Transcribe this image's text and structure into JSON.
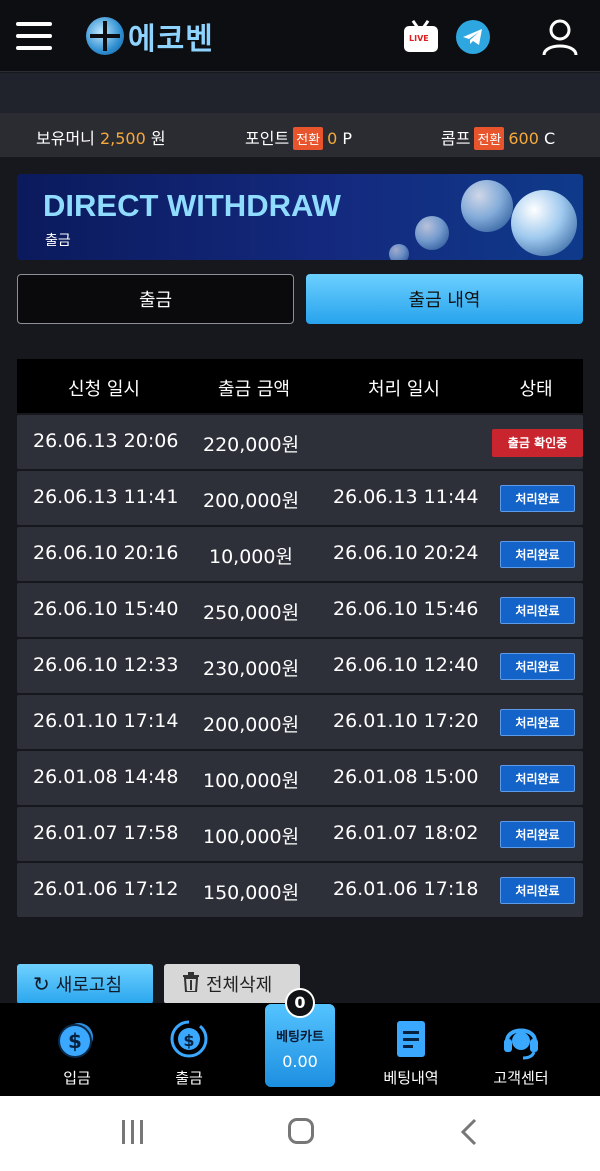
{
  "header": {
    "logo_text": "에코벤",
    "live_label": "LIVE"
  },
  "balance": {
    "money_label": "보유머니",
    "money_value": "2,500",
    "money_unit": "원",
    "point_label": "포인트",
    "point_badge": "전환",
    "point_value": "0",
    "point_unit": "P",
    "comp_label": "콤프",
    "comp_badge": "전환",
    "comp_value": "600",
    "comp_unit": "C"
  },
  "banner": {
    "title": "DIRECT WITHDRAW",
    "subtitle": "출금"
  },
  "tabs": {
    "withdraw": "출금",
    "history": "출금 내역"
  },
  "table": {
    "headers": [
      "신청 일시",
      "출금 금액",
      "처리 일시",
      "상태"
    ],
    "rows": [
      {
        "requested": "26.06.13 20:06",
        "amount": "220,000원",
        "processed": "",
        "status": "출금 확인중"
      },
      {
        "requested": "26.06.13 11:41",
        "amount": "200,000원",
        "processed": "26.06.13 11:44",
        "status": "처리완료"
      },
      {
        "requested": "26.06.10 20:16",
        "amount": "10,000원",
        "processed": "26.06.10 20:24",
        "status": "처리완료"
      },
      {
        "requested": "26.06.10 15:40",
        "amount": "250,000원",
        "processed": "26.06.10 15:46",
        "status": "처리완료"
      },
      {
        "requested": "26.06.10 12:33",
        "amount": "230,000원",
        "processed": "26.06.10 12:40",
        "status": "처리완료"
      },
      {
        "requested": "26.01.10 17:14",
        "amount": "200,000원",
        "processed": "26.01.10 17:20",
        "status": "처리완료"
      },
      {
        "requested": "26.01.08 14:48",
        "amount": "100,000원",
        "processed": "26.01.08 15:00",
        "status": "처리완료"
      },
      {
        "requested": "26.01.07 17:58",
        "amount": "100,000원",
        "processed": "26.01.07 18:02",
        "status": "처리완료"
      },
      {
        "requested": "26.01.06 17:12",
        "amount": "150,000원",
        "processed": "26.01.06 17:18",
        "status": "처리완료"
      }
    ]
  },
  "actions": {
    "refresh": "새로고침",
    "delete_all": "전체삭제"
  },
  "bottom_nav": {
    "deposit": "입금",
    "withdraw": "출금",
    "cart_label": "베팅카트",
    "cart_value": "0.00",
    "cart_count": "0",
    "bet_history": "베팅내역",
    "support": "고객센터"
  },
  "colors": {
    "accent": "#f6a93b",
    "status_done": "#1463c9",
    "status_pending": "#c8252e",
    "tab_active": "#27a3ec"
  }
}
